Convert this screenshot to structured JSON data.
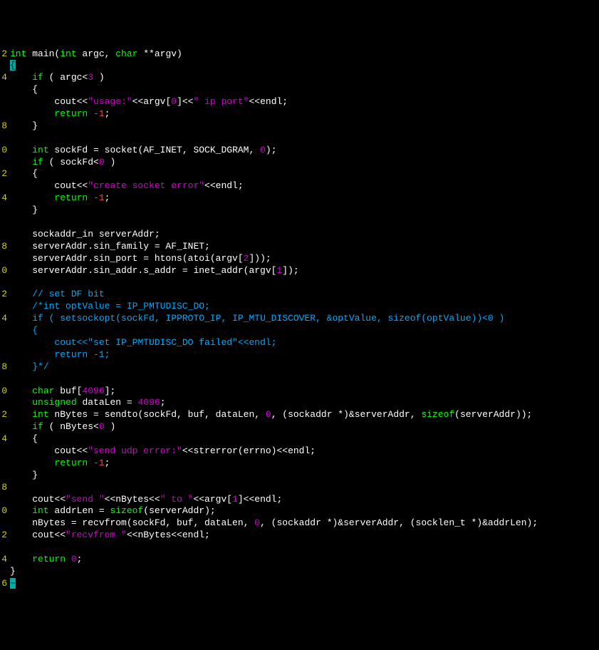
{
  "gutter": [
    "2",
    "",
    "4",
    "",
    "",
    "",
    "8",
    "",
    "0",
    "",
    "2",
    "",
    "4",
    "",
    "",
    "",
    "8",
    "",
    "0",
    "",
    "2",
    "",
    "4",
    "",
    "",
    "",
    "8",
    "",
    "0",
    "",
    "2",
    "",
    "4",
    "",
    "",
    "",
    "8",
    "",
    "0",
    "",
    "2",
    "",
    "4",
    "",
    "6"
  ],
  "lines": [
    {
      "tokens": [
        {
          "c": "kw",
          "t": "int"
        },
        {
          "c": "def",
          "t": " main("
        },
        {
          "c": "kw",
          "t": "int"
        },
        {
          "c": "def",
          "t": " argc, "
        },
        {
          "c": "kw",
          "t": "char"
        },
        {
          "c": "def",
          "t": " **argv)"
        }
      ]
    },
    {
      "tokens": [
        {
          "c": "cursor-brace",
          "t": "{"
        }
      ]
    },
    {
      "tokens": [
        {
          "c": "def",
          "t": "    "
        },
        {
          "c": "kw",
          "t": "if"
        },
        {
          "c": "def",
          "t": " ( argc<"
        },
        {
          "c": "num",
          "t": "3"
        },
        {
          "c": "def",
          "t": " )"
        }
      ]
    },
    {
      "tokens": [
        {
          "c": "def",
          "t": "    {"
        }
      ]
    },
    {
      "tokens": [
        {
          "c": "def",
          "t": "        cout<<"
        },
        {
          "c": "str",
          "t": "\"usage:\""
        },
        {
          "c": "def",
          "t": "<<argv["
        },
        {
          "c": "num",
          "t": "0"
        },
        {
          "c": "def",
          "t": "]<<"
        },
        {
          "c": "str",
          "t": "\" ip port\""
        },
        {
          "c": "def",
          "t": "<<endl;"
        }
      ]
    },
    {
      "tokens": [
        {
          "c": "def",
          "t": "        "
        },
        {
          "c": "kw",
          "t": "return"
        },
        {
          "c": "def",
          "t": " "
        },
        {
          "c": "red",
          "t": "-1"
        },
        {
          "c": "def",
          "t": ";"
        }
      ]
    },
    {
      "tokens": [
        {
          "c": "def",
          "t": "    }"
        }
      ]
    },
    {
      "tokens": [
        {
          "c": "def",
          "t": ""
        }
      ]
    },
    {
      "tokens": [
        {
          "c": "def",
          "t": "    "
        },
        {
          "c": "kw",
          "t": "int"
        },
        {
          "c": "def",
          "t": " sockFd = socket(AF_INET, SOCK_DGRAM, "
        },
        {
          "c": "num",
          "t": "0"
        },
        {
          "c": "def",
          "t": ");"
        }
      ]
    },
    {
      "tokens": [
        {
          "c": "def",
          "t": "    "
        },
        {
          "c": "kw",
          "t": "if"
        },
        {
          "c": "def",
          "t": " ( sockFd<"
        },
        {
          "c": "num",
          "t": "0"
        },
        {
          "c": "def",
          "t": " )"
        }
      ]
    },
    {
      "tokens": [
        {
          "c": "def",
          "t": "    {"
        }
      ]
    },
    {
      "tokens": [
        {
          "c": "def",
          "t": "        cout<<"
        },
        {
          "c": "str",
          "t": "\"create socket error\""
        },
        {
          "c": "def",
          "t": "<<endl;"
        }
      ]
    },
    {
      "tokens": [
        {
          "c": "def",
          "t": "        "
        },
        {
          "c": "kw",
          "t": "return"
        },
        {
          "c": "def",
          "t": " "
        },
        {
          "c": "red",
          "t": "-1"
        },
        {
          "c": "def",
          "t": ";"
        }
      ]
    },
    {
      "tokens": [
        {
          "c": "def",
          "t": "    }"
        }
      ]
    },
    {
      "tokens": [
        {
          "c": "def",
          "t": ""
        }
      ]
    },
    {
      "tokens": [
        {
          "c": "def",
          "t": "    sockaddr_in serverAddr;"
        }
      ]
    },
    {
      "tokens": [
        {
          "c": "def",
          "t": "    serverAddr.sin_family = AF_INET;"
        }
      ]
    },
    {
      "tokens": [
        {
          "c": "def",
          "t": "    serverAddr.sin_port = htons(atoi(argv["
        },
        {
          "c": "num",
          "t": "2"
        },
        {
          "c": "def",
          "t": "]));"
        }
      ]
    },
    {
      "tokens": [
        {
          "c": "def",
          "t": "    serverAddr.sin_addr.s_addr = inet_addr(argv["
        },
        {
          "c": "num",
          "t": "1"
        },
        {
          "c": "def",
          "t": "]);"
        }
      ]
    },
    {
      "tokens": [
        {
          "c": "def",
          "t": ""
        }
      ]
    },
    {
      "tokens": [
        {
          "c": "def",
          "t": "    "
        },
        {
          "c": "cmt",
          "t": "// set DF bit"
        }
      ]
    },
    {
      "tokens": [
        {
          "c": "def",
          "t": "    "
        },
        {
          "c": "cmt",
          "t": "/*int optValue = IP_PMTUDISC_DO;"
        }
      ]
    },
    {
      "tokens": [
        {
          "c": "def",
          "t": "    "
        },
        {
          "c": "cmt",
          "t": "if ( setsockopt(sockFd, IPPROTO_IP, IP_MTU_DISCOVER, &optValue, sizeof(optValue))<0 )"
        }
      ]
    },
    {
      "tokens": [
        {
          "c": "def",
          "t": "    "
        },
        {
          "c": "cmt",
          "t": "{"
        }
      ]
    },
    {
      "tokens": [
        {
          "c": "def",
          "t": "    "
        },
        {
          "c": "cmt",
          "t": "    cout<<\"set IP_PMTUDISC_DO failed\"<<endl;"
        }
      ]
    },
    {
      "tokens": [
        {
          "c": "def",
          "t": "    "
        },
        {
          "c": "cmt",
          "t": "    return -1;"
        }
      ]
    },
    {
      "tokens": [
        {
          "c": "def",
          "t": "    "
        },
        {
          "c": "cmt",
          "t": "}*/"
        }
      ]
    },
    {
      "tokens": [
        {
          "c": "def",
          "t": ""
        }
      ]
    },
    {
      "tokens": [
        {
          "c": "def",
          "t": "    "
        },
        {
          "c": "kw",
          "t": "char"
        },
        {
          "c": "def",
          "t": " buf["
        },
        {
          "c": "num",
          "t": "4096"
        },
        {
          "c": "def",
          "t": "];"
        }
      ]
    },
    {
      "tokens": [
        {
          "c": "def",
          "t": "    "
        },
        {
          "c": "kw",
          "t": "unsigned"
        },
        {
          "c": "def",
          "t": " dataLen = "
        },
        {
          "c": "num",
          "t": "4096"
        },
        {
          "c": "def",
          "t": ";"
        }
      ]
    },
    {
      "tokens": [
        {
          "c": "def",
          "t": "    "
        },
        {
          "c": "kw",
          "t": "int"
        },
        {
          "c": "def",
          "t": " nBytes = sendto(sockFd, buf, dataLen, "
        },
        {
          "c": "num",
          "t": "0"
        },
        {
          "c": "def",
          "t": ", (sockaddr *)&serverAddr, "
        },
        {
          "c": "kw",
          "t": "sizeof"
        },
        {
          "c": "def",
          "t": "(serverAddr));"
        }
      ]
    },
    {
      "tokens": [
        {
          "c": "def",
          "t": "    "
        },
        {
          "c": "kw",
          "t": "if"
        },
        {
          "c": "def",
          "t": " ( nBytes<"
        },
        {
          "c": "num",
          "t": "0"
        },
        {
          "c": "def",
          "t": " )"
        }
      ]
    },
    {
      "tokens": [
        {
          "c": "def",
          "t": "    {"
        }
      ]
    },
    {
      "tokens": [
        {
          "c": "def",
          "t": "        cout<<"
        },
        {
          "c": "str",
          "t": "\"send udp error:\""
        },
        {
          "c": "def",
          "t": "<<strerror(errno)<<endl;"
        }
      ]
    },
    {
      "tokens": [
        {
          "c": "def",
          "t": "        "
        },
        {
          "c": "kw",
          "t": "return"
        },
        {
          "c": "def",
          "t": " "
        },
        {
          "c": "red",
          "t": "-1"
        },
        {
          "c": "def",
          "t": ";"
        }
      ]
    },
    {
      "tokens": [
        {
          "c": "def",
          "t": "    }"
        }
      ]
    },
    {
      "tokens": [
        {
          "c": "def",
          "t": ""
        }
      ]
    },
    {
      "tokens": [
        {
          "c": "def",
          "t": "    cout<<"
        },
        {
          "c": "str",
          "t": "\"send \""
        },
        {
          "c": "def",
          "t": "<<nBytes<<"
        },
        {
          "c": "str",
          "t": "\" to \""
        },
        {
          "c": "def",
          "t": "<<argv["
        },
        {
          "c": "num",
          "t": "1"
        },
        {
          "c": "def",
          "t": "]<<endl;"
        }
      ]
    },
    {
      "tokens": [
        {
          "c": "def",
          "t": "    "
        },
        {
          "c": "kw",
          "t": "int"
        },
        {
          "c": "def",
          "t": " addrLen = "
        },
        {
          "c": "kw",
          "t": "sizeof"
        },
        {
          "c": "def",
          "t": "(serverAddr);"
        }
      ]
    },
    {
      "tokens": [
        {
          "c": "def",
          "t": "    nBytes = recvfrom(sockFd, buf, dataLen, "
        },
        {
          "c": "num",
          "t": "0"
        },
        {
          "c": "def",
          "t": ", (sockaddr *)&serverAddr, (socklen_t *)&addrLen);"
        }
      ]
    },
    {
      "tokens": [
        {
          "c": "def",
          "t": "    cout<<"
        },
        {
          "c": "str",
          "t": "\"recvfrom \""
        },
        {
          "c": "def",
          "t": "<<nBytes<<endl;"
        }
      ]
    },
    {
      "tokens": [
        {
          "c": "def",
          "t": ""
        }
      ]
    },
    {
      "tokens": [
        {
          "c": "def",
          "t": "    "
        },
        {
          "c": "kw",
          "t": "return"
        },
        {
          "c": "def",
          "t": " "
        },
        {
          "c": "num",
          "t": "0"
        },
        {
          "c": "def",
          "t": ";"
        }
      ]
    },
    {
      "tokens": [
        {
          "c": "def",
          "t": "} "
        }
      ]
    },
    {
      "tokens": [
        {
          "c": "cursor-brace",
          "t": "~"
        }
      ]
    }
  ]
}
